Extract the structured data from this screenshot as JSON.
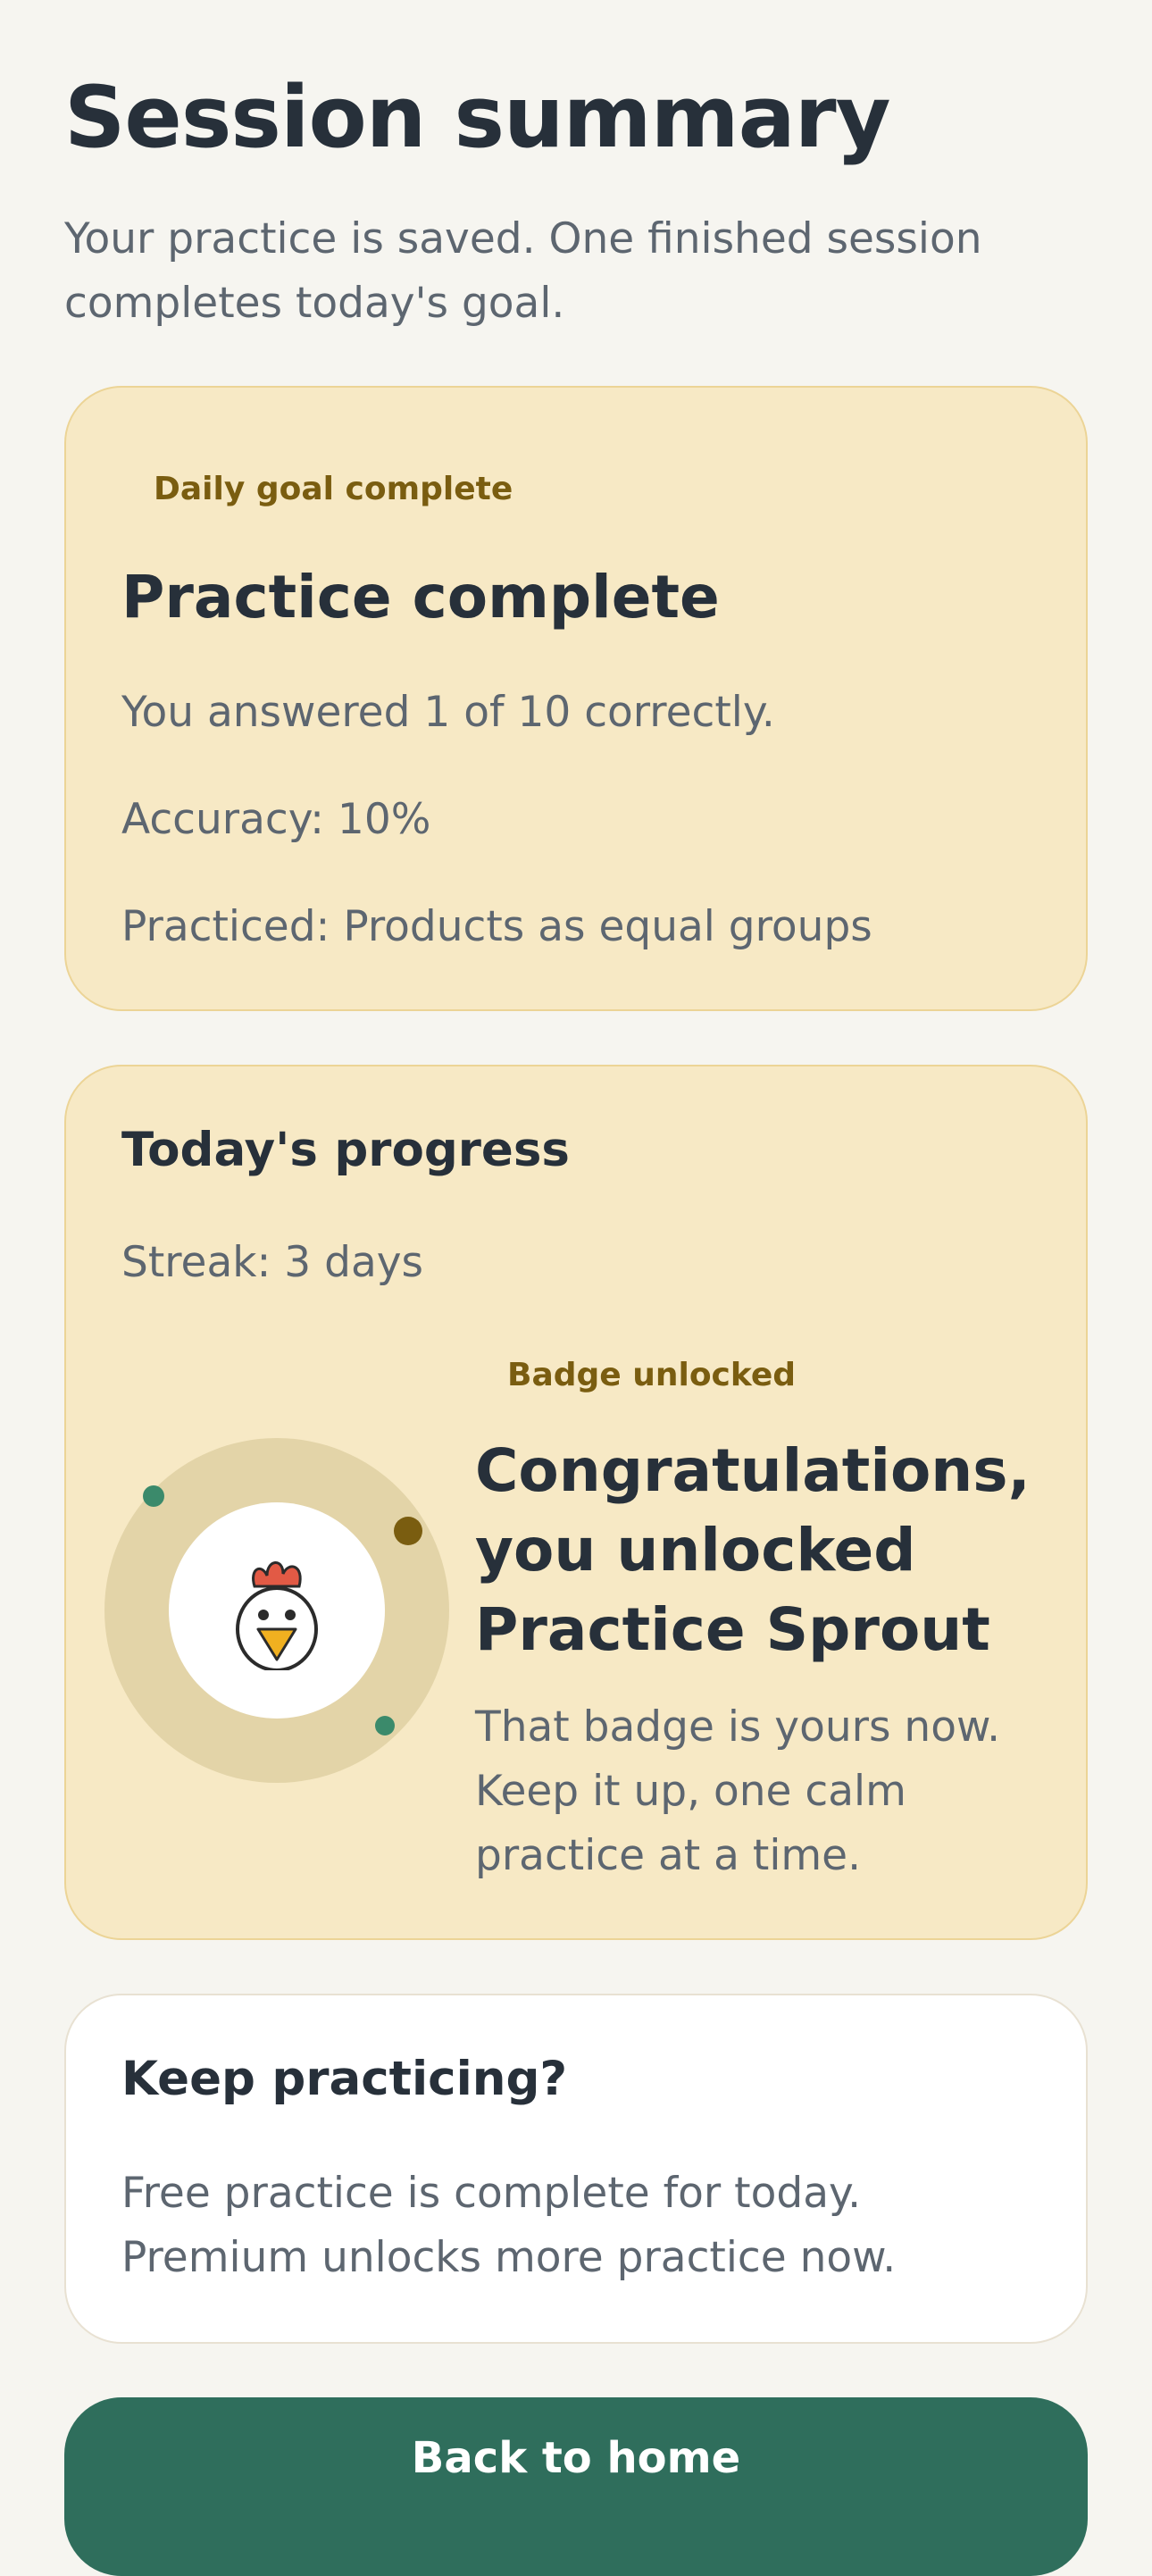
{
  "header": {
    "title": "Session summary",
    "subtitle": "Your practice is saved. One finished session completes today's goal."
  },
  "result_card": {
    "eyebrow": "Daily goal complete",
    "title": "Practice complete",
    "answered": "You answered 1 of 10 correctly.",
    "accuracy": "Accuracy: 10%",
    "practiced": "Practiced: Products as equal groups"
  },
  "progress_card": {
    "title": "Today's progress",
    "streak": "Streak: 3 days",
    "badge": {
      "eyebrow": "Badge unlocked",
      "title": "Congratulations, you unlocked Practice Sprout",
      "body": "That badge is yours now. Keep it up, one calm practice at a time.",
      "icon": "chicken-icon"
    }
  },
  "upsell_card": {
    "title": "Keep practicing?",
    "body": "Free practice is complete for today. Premium unlocks more practice now."
  },
  "actions": {
    "back_home": "Back to home"
  },
  "colors": {
    "background": "#f6f5f0",
    "card_yellow": "#f7e9c5",
    "card_border": "#ecd496",
    "eyebrow_text": "#7a5d10",
    "primary_button": "#2f6e5c",
    "heading_text": "#27303a",
    "body_text": "#5d6670",
    "accent_green": "#3b8a6b",
    "accent_brown": "#7a5d10"
  }
}
